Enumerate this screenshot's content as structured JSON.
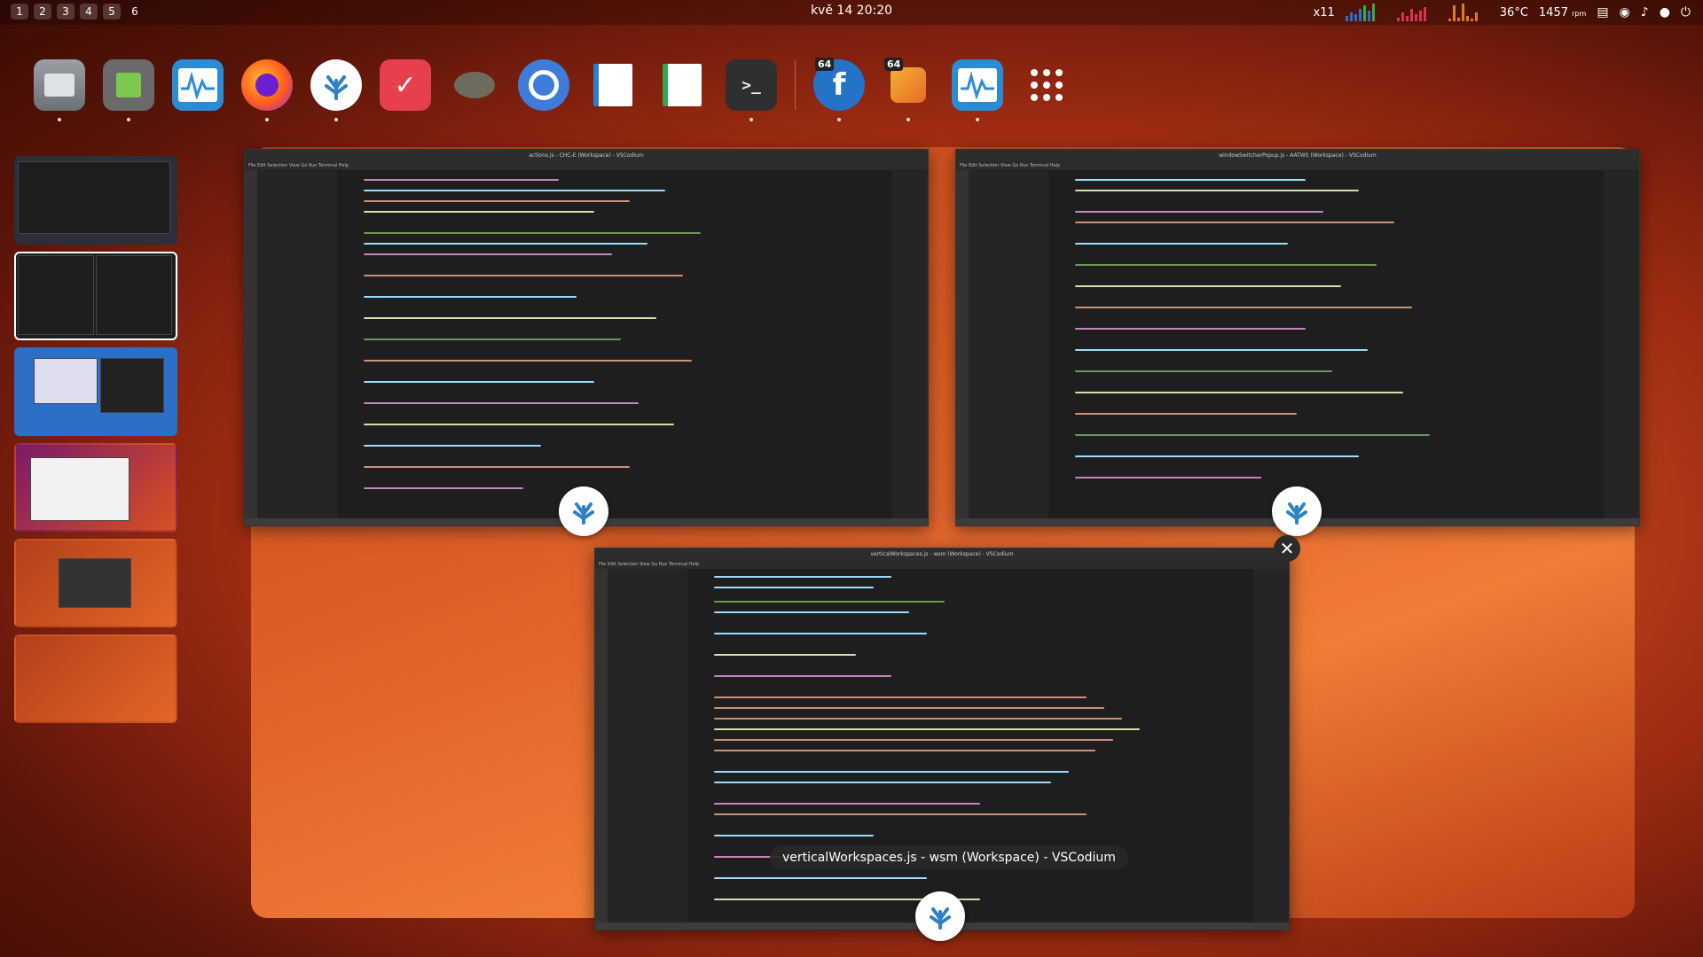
{
  "topbar": {
    "workspaces": [
      "1",
      "2",
      "3",
      "4",
      "5",
      "6"
    ],
    "clock": "kvě 14  20:20",
    "x11_label": "x11",
    "cpu_temp": "36°C",
    "fan_rpm": "1457",
    "fan_unit": "rpm"
  },
  "dock": {
    "apps": [
      {
        "name": "Files",
        "icon": "files-icon"
      },
      {
        "name": "Extensions",
        "icon": "puzzle-icon"
      },
      {
        "name": "System Monitor",
        "icon": "monitor-icon"
      },
      {
        "name": "Firefox",
        "icon": "firefox-icon"
      },
      {
        "name": "VSCodium",
        "icon": "vscodium-icon"
      },
      {
        "name": "Todo",
        "icon": "todo-icon"
      },
      {
        "name": "GIMP",
        "icon": "gimp-icon"
      },
      {
        "name": "Chromium",
        "icon": "chromium-icon"
      },
      {
        "name": "Writer",
        "icon": "writer-icon"
      },
      {
        "name": "Calc",
        "icon": "calc-icon"
      },
      {
        "name": "Terminal",
        "icon": "terminal-icon"
      }
    ],
    "badge": "64",
    "terminal_glyph": ">_"
  },
  "windows": {
    "left_title": "actions.js - CHC-E (Workspace) - VSCodium",
    "right_title": "windowSwitcherPopup.js - AATWS (Workspace) - VSCodium",
    "center_title": "verticalWorkspaces.js - wsm (Workspace) - VSCodium",
    "menu": "File  Edit  Selection  View  Go  Run  Terminal  Help"
  },
  "tooltip": "verticalWorkspaces.js - wsm (Workspace) - VSCodium",
  "close_label": "✕"
}
